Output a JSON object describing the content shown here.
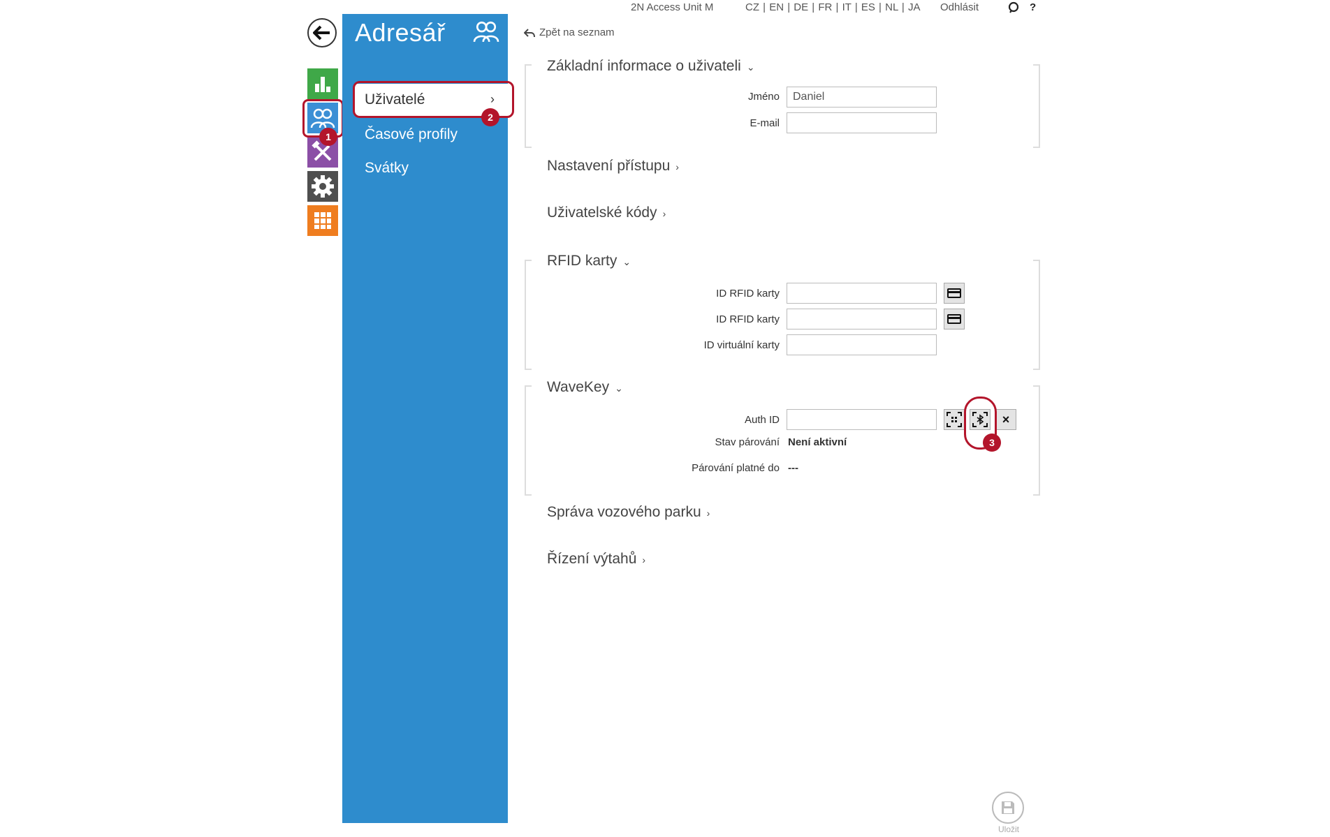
{
  "topbar": {
    "device": "2N Access Unit M",
    "languages": "CZ | EN | DE | FR | IT | ES | NL | JA",
    "logout": "Odhlásit",
    "help": "?"
  },
  "rail": {
    "icons": [
      "back-arrow-icon",
      "statistics-icon",
      "users-icon",
      "services-icon",
      "settings-icon",
      "apps-grid-icon"
    ]
  },
  "menu": {
    "title": "Adresář",
    "items": [
      {
        "label": "Uživatelé",
        "chevron": "›"
      },
      {
        "label": "Časové profily"
      },
      {
        "label": "Svátky"
      }
    ]
  },
  "content": {
    "back_link": "Zpět na seznam",
    "basic": {
      "title": "Základní informace o uživateli",
      "name_label": "Jméno",
      "name_value": "Daniel",
      "email_label": "E-mail",
      "email_value": ""
    },
    "access": {
      "title": "Nastavení přístupu"
    },
    "codes": {
      "title": "Uživatelské kódy"
    },
    "rfid": {
      "title": "RFID karty",
      "card1_label": "ID RFID karty",
      "card2_label": "ID RFID karty",
      "virtual_label": "ID virtuální karty"
    },
    "wavekey": {
      "title": "WaveKey",
      "auth_label": "Auth ID",
      "pair_state_label": "Stav párování",
      "pair_state_value": "Není aktivní",
      "pair_valid_label": "Párování platné do",
      "pair_valid_value": "---",
      "clear_symbol": "×"
    },
    "fleet": {
      "title": "Správa vozového parku"
    },
    "elevators": {
      "title": "Řízení výtahů"
    }
  },
  "callouts": [
    "1",
    "2",
    "3"
  ],
  "save": {
    "label": "Uložit"
  },
  "colors": {
    "menu_blue": "#2e8ccd",
    "callout_red": "#b3152b",
    "tile_green": "#3fa848",
    "tile_blue": "#3b8fd5",
    "tile_purple": "#8b4fa6",
    "tile_gray": "#4f4f4f",
    "tile_orange": "#ef7d1f"
  }
}
